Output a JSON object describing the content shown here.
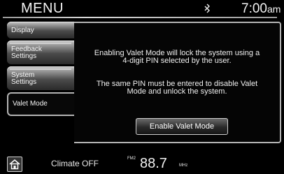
{
  "header": {
    "title": "MENU",
    "status_icon": "phone-signal-icon",
    "clock": "7:00",
    "ampm": "am"
  },
  "sidebar": {
    "items": [
      {
        "line1": "Display",
        "line2": "",
        "active": false
      },
      {
        "line1": "Feedback",
        "line2": "Settings",
        "active": false
      },
      {
        "line1": "System",
        "line2": "Settings",
        "active": false
      },
      {
        "line1": "Valet Mode",
        "line2": "",
        "active": true
      }
    ]
  },
  "main": {
    "message1_line1": "Enabling Valet Mode will lock the system using a",
    "message1_line2": "4-digit PIN selected by the user.",
    "message2_line1": "The same PIN must be entered to disable Valet",
    "message2_line2": "Mode and unlock the system.",
    "button_label": "Enable Valet Mode"
  },
  "bottom_bar": {
    "home_icon": "home-icon",
    "climate": "Climate OFF",
    "band": "FM2",
    "frequency": "88.7",
    "unit": "MHz"
  }
}
